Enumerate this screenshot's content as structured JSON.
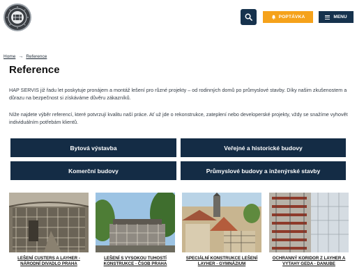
{
  "header": {
    "search_icon": "search-icon",
    "poptavka_label": "POPTÁVKA",
    "menu_label": "MENU"
  },
  "breadcrumb": {
    "home": "Home",
    "separator": "→",
    "current": "Reference"
  },
  "page": {
    "title": "Reference",
    "intro": "HAP SERVIS již řadu let poskytuje pronájem a montáž lešení pro různé projekty – od rodinných domů po průmyslové stavby. Díky našim zkušenostem a důrazu na bezpečnost si získáváme důvěru zákazníků.",
    "intro2": "Níže najdete výběr referencí, které potvrzují kvalitu naší práce. Ať už jde o rekonstrukce, zateplení nebo developerské projekty, vždy se snažíme vyhovět individuálním potřebám klientů."
  },
  "categories": [
    "Bytová výstavba",
    "Veřejné a historické budovy",
    "Komerční budovy",
    "Průmyslové budovy a inženýrské stavby"
  ],
  "cards": [
    {
      "caption": "LEŠENÍ CUSTERS A LAYHER - NÁRODNÍ DIVADLO PRAHA"
    },
    {
      "caption": "LEŠENÍ S VYSOKOU TUHOSTÍ KONSTRUKCE - ČSOB PRAHA"
    },
    {
      "caption": "SPECIÁLNÍ KONSTRUKCE LEŠENÍ LAYHER - GYMNÁZIUM"
    },
    {
      "caption": "OCHRANNÝ KORIDOR Z LAYHER A VYTAHY GEDA - DANUBE"
    }
  ],
  "colors": {
    "navy": "#142c45",
    "accent": "#f5a21b"
  }
}
